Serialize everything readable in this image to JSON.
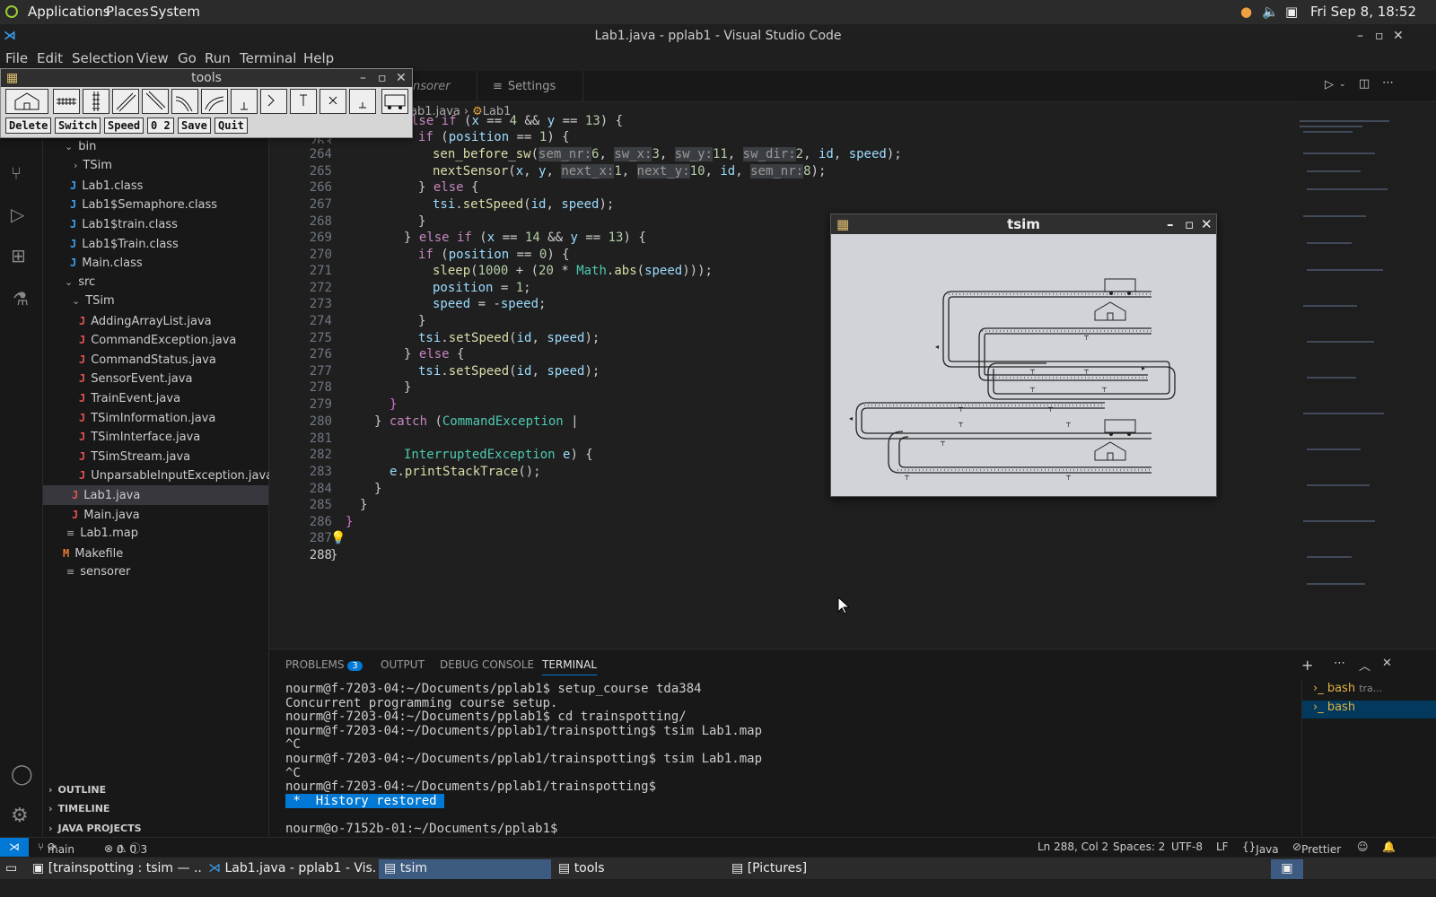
{
  "gnome": {
    "applications": "Applications",
    "places": "Places",
    "system": "System",
    "clock": "Fri Sep 8, 18:52"
  },
  "window": {
    "title": "Lab1.java - pplab1 - Visual Studio Code"
  },
  "menu": [
    "File",
    "Edit",
    "Selection",
    "View",
    "Go",
    "Run",
    "Terminal",
    "Help"
  ],
  "tabs": {
    "partial": "nsorer",
    "settings": "Settings"
  },
  "breadcrumb": {
    "file": "Lab1.java",
    "cls": "Lab1",
    "file_partial": "ab1.java"
  },
  "tree": {
    "bin": "bin",
    "tsim1": "TSim",
    "lab1class": "Lab1.class",
    "sem": "Lab1$Semaphore.class",
    "train1": "Lab1$train.class",
    "train2": "Lab1$Train.class",
    "mainclass": "Main.class",
    "src": "src",
    "tsim2": "TSim",
    "f1": "AddingArrayList.java",
    "f2": "CommandException.java",
    "f3": "CommandStatus.java",
    "f4": "SensorEvent.java",
    "f5": "TrainEvent.java",
    "f6": "TSimInformation.java",
    "f7": "TSimInterface.java",
    "f8": "TSimStream.java",
    "f9": "UnparsableInputException.java",
    "lab1": "Lab1.java",
    "main": "Main.java",
    "map": "Lab1.map",
    "make": "Makefile",
    "sens": "sensorer"
  },
  "outline": {
    "outline": "OUTLINE",
    "timeline": "TIMELINE",
    "java": "JAVA PROJECTS"
  },
  "lines": [
    "263",
    "264",
    "265",
    "266",
    "267",
    "268",
    "269",
    "270",
    "271",
    "272",
    "273",
    "274",
    "275",
    "276",
    "277",
    "278",
    "279",
    "280",
    "281",
    "282",
    "283",
    "284",
    "285",
    "286",
    "287",
    "288"
  ],
  "panel": {
    "problems": "PROBLEMS",
    "problems_count": "3",
    "output": "OUTPUT",
    "debug": "DEBUG CONSOLE",
    "terminal": "TERMINAL",
    "bash1": "bash",
    "bash1_sub": "tra...",
    "bash2": "bash"
  },
  "term": [
    "nourm@f-7203-04:~/Documents/pplab1$ setup_course tda384",
    "Concurrent programming course setup.",
    "nourm@f-7203-04:~/Documents/pplab1$ cd trainspotting/",
    "nourm@f-7203-04:~/Documents/pplab1/trainspotting$ tsim Lab1.map",
    "^C",
    "nourm@f-7203-04:~/Documents/pplab1/trainspotting$ tsim Lab1.map",
    "^C",
    "nourm@f-7203-04:~/Documents/pplab1/trainspotting$",
    " *  History restored ",
    "nourm@o-7152b-01:~/Documents/pplab1$ "
  ],
  "status": {
    "branch": "main",
    "errors": "0",
    "warnings": "0",
    "info": "3",
    "pos": "Ln 288, Col 2",
    "spaces": "Spaces: 2",
    "enc": "UTF-8",
    "eol": "LF",
    "lang": "Java",
    "prettier": "Prettier"
  },
  "taskbar": [
    "[trainspotting : tsim — ...",
    "Lab1.java - pplab1 - Vis...",
    "tsim",
    "tools",
    "[Pictures]"
  ],
  "tools": {
    "title": "tools",
    "delete": "Delete",
    "switch": "Switch",
    "speed": "Speed",
    "nums": "0 2",
    "save": "Save",
    "quit": "Quit"
  },
  "tsim": {
    "title": "tsim"
  },
  "colors": {
    "accent": "#0078d4",
    "keyword": "#c586c0",
    "function": "#dcdcaa"
  }
}
